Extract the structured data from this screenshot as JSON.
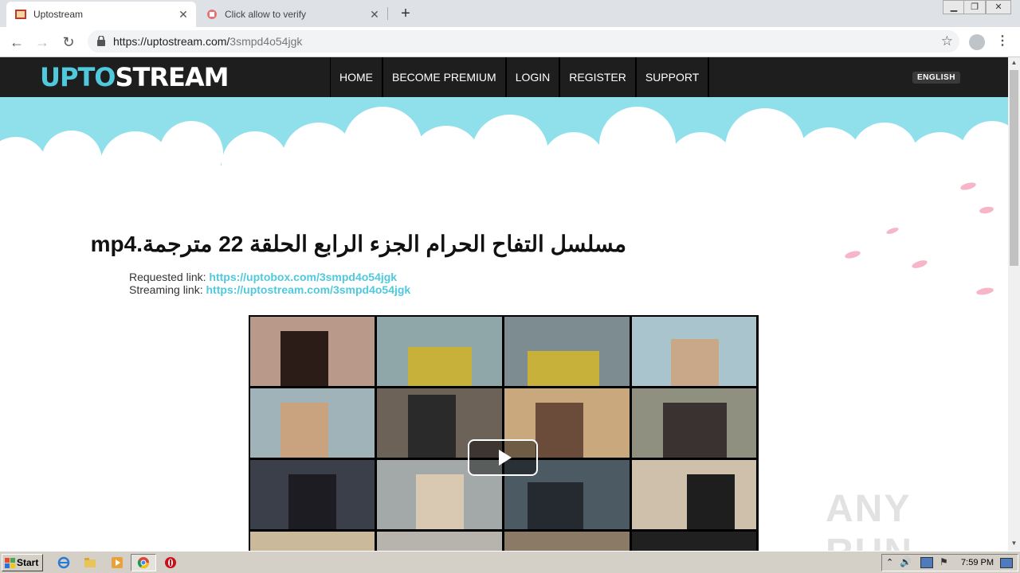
{
  "browser": {
    "tabs": [
      {
        "title": "Uptostream",
        "active": true
      },
      {
        "title": "Click allow to verify",
        "active": false
      }
    ],
    "url_host": "https://uptostream.com/",
    "url_path": "3smpd4o54jgk"
  },
  "site": {
    "logo_part1": "UPTO",
    "logo_part2": "STREAM",
    "nav": [
      "HOME",
      "BECOME PREMIUM",
      "LOGIN",
      "REGISTER",
      "SUPPORT"
    ],
    "language": "ENGLISH"
  },
  "video": {
    "title": "مسلسل التفاح الحرام الجزء الرابع الحلقة 22 مترجمة.mp4",
    "requested_label": "Requested link:",
    "requested_url": "https://uptobox.com/3smpd4o54jgk",
    "streaming_label": "Streaming link:",
    "streaming_url": "https://uptostream.com/3smpd4o54jgk"
  },
  "watermark": "ANY RUN",
  "taskbar": {
    "start_label": "Start",
    "clock": "7:59 PM"
  },
  "colors": {
    "accent": "#4fc9db",
    "nav_bg": "#1e1e1e",
    "sky": "#8fe0ea"
  }
}
